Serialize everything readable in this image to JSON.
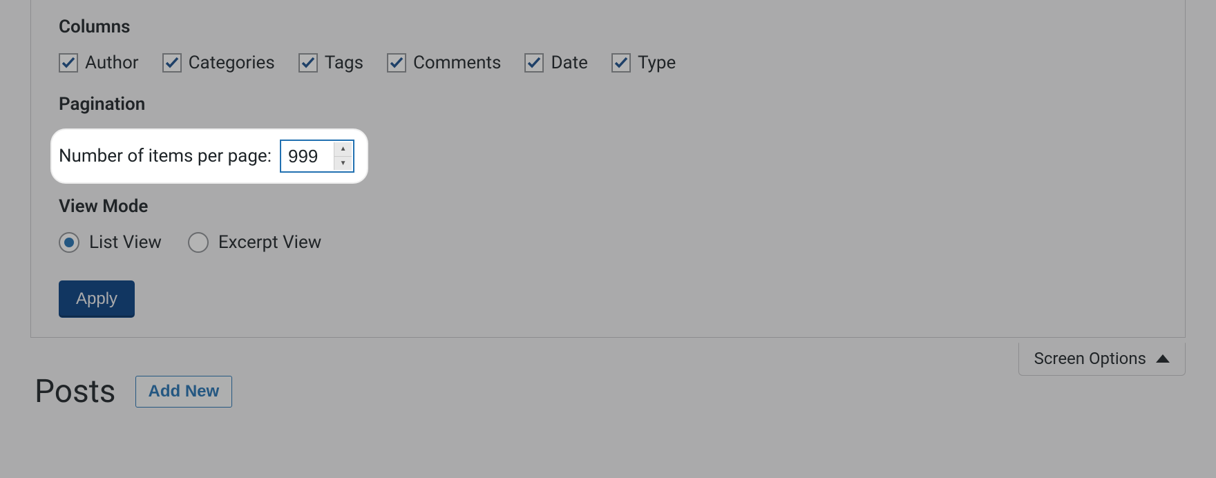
{
  "screen_options": {
    "tab_label": "Screen Options",
    "columns_heading": "Columns",
    "columns": [
      {
        "label": "Author",
        "checked": true
      },
      {
        "label": "Categories",
        "checked": true
      },
      {
        "label": "Tags",
        "checked": true
      },
      {
        "label": "Comments",
        "checked": true
      },
      {
        "label": "Date",
        "checked": true
      },
      {
        "label": "Type",
        "checked": true
      }
    ],
    "pagination_heading": "Pagination",
    "items_per_page_label": "Number of items per page:",
    "items_per_page_value": "999",
    "view_mode_heading": "View Mode",
    "view_modes": [
      {
        "label": "List View",
        "selected": true
      },
      {
        "label": "Excerpt View",
        "selected": false
      }
    ],
    "apply_label": "Apply"
  },
  "page": {
    "title": "Posts",
    "add_new_label": "Add New"
  }
}
